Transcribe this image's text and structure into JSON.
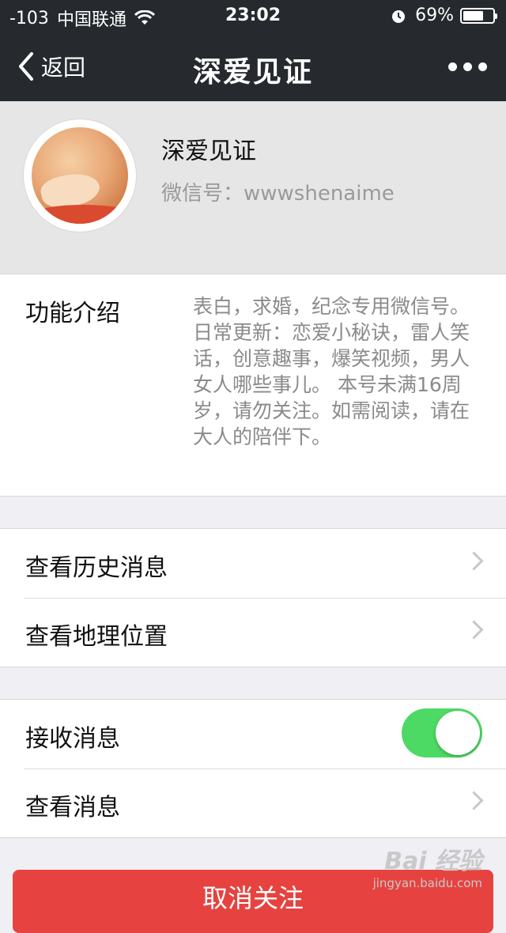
{
  "status_bar": {
    "signal": "-103",
    "carrier": "中国联通",
    "time": "23:02",
    "battery": "69%",
    "battery_level": 0.69
  },
  "nav": {
    "back_label": "返回",
    "title": "深爱见证"
  },
  "profile": {
    "name": "深爱见证",
    "wechat_id": "微信号：wwwshenaime"
  },
  "intro": {
    "label": "功能介绍",
    "text": "表白，求婚，纪念专用微信号。 日常更新：恋爱小秘诀，雷人笑话，创意趣事，爆笑视频，男人女人哪些事儿。 本号未满16周岁，请勿关注。如需阅读，请在大人的陪伴下。"
  },
  "group1": {
    "history_label": "查看历史消息",
    "location_label": "查看地理位置"
  },
  "group2": {
    "receive_label": "接收消息",
    "receive_on": true,
    "view_label": "查看消息"
  },
  "unfollow_label": "取消关注",
  "watermark": {
    "brand": "Bai 经验",
    "url": "jingyan.baidu.com"
  },
  "colors": {
    "nav_bg": "#262a2e",
    "toggle_on": "#4cd964",
    "danger": "#e64340"
  }
}
